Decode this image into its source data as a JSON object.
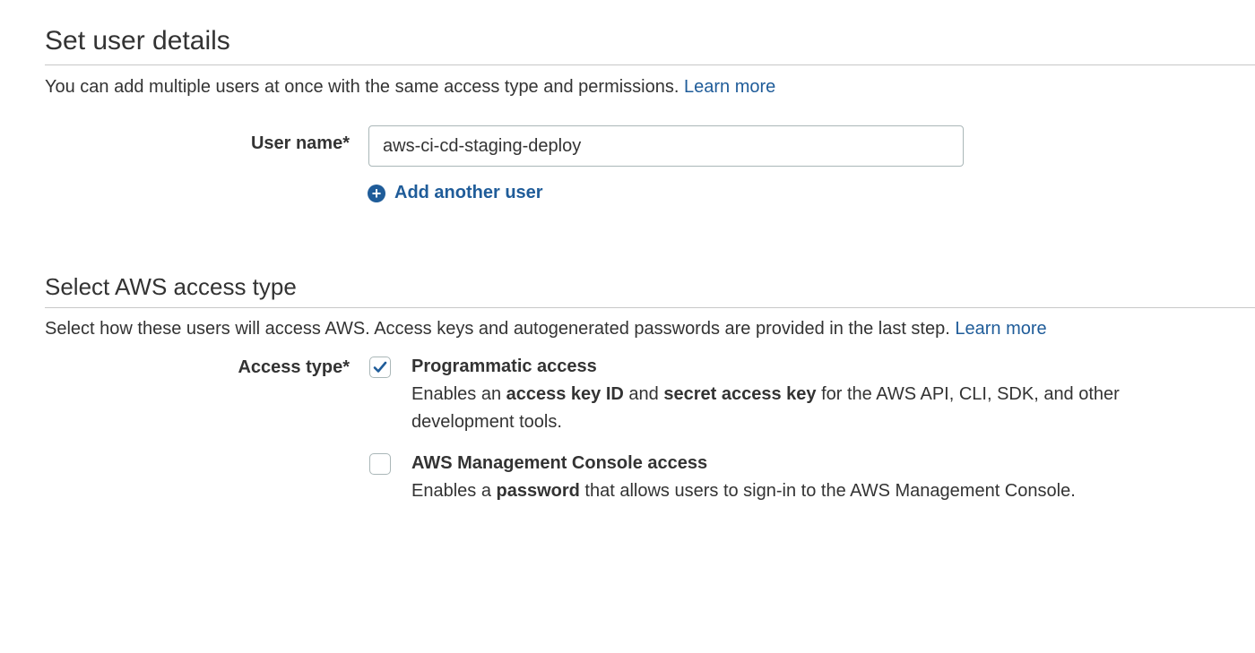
{
  "user_details": {
    "title": "Set user details",
    "description": "You can add multiple users at once with the same access type and permissions.",
    "learn_more": "Learn more",
    "user_name_label": "User name*",
    "user_name_value": "aws-ci-cd-staging-deploy",
    "add_another_user": "Add another user",
    "add_icon": "plus-circle-icon"
  },
  "access_type": {
    "title": "Select AWS access type",
    "description": "Select how these users will access AWS. Access keys and autogenerated passwords are provided in the last step.",
    "learn_more": "Learn more",
    "label": "Access type*",
    "options": [
      {
        "title": "Programmatic access",
        "checked": true,
        "desc_parts": [
          {
            "text": "Enables an ",
            "bold": false
          },
          {
            "text": "access key ID",
            "bold": true
          },
          {
            "text": " and ",
            "bold": false
          },
          {
            "text": "secret access key",
            "bold": true
          },
          {
            "text": " for the AWS API, CLI, SDK, and other development tools.",
            "bold": false
          }
        ]
      },
      {
        "title": "AWS Management Console access",
        "checked": false,
        "desc_parts": [
          {
            "text": "Enables a ",
            "bold": false
          },
          {
            "text": "password",
            "bold": true
          },
          {
            "text": " that allows users to sign-in to the AWS Management Console.",
            "bold": false
          }
        ]
      }
    ]
  },
  "colors": {
    "link": "#1f5c99",
    "text": "#333333",
    "border": "#aab7b8",
    "check": "#1f5c99"
  }
}
